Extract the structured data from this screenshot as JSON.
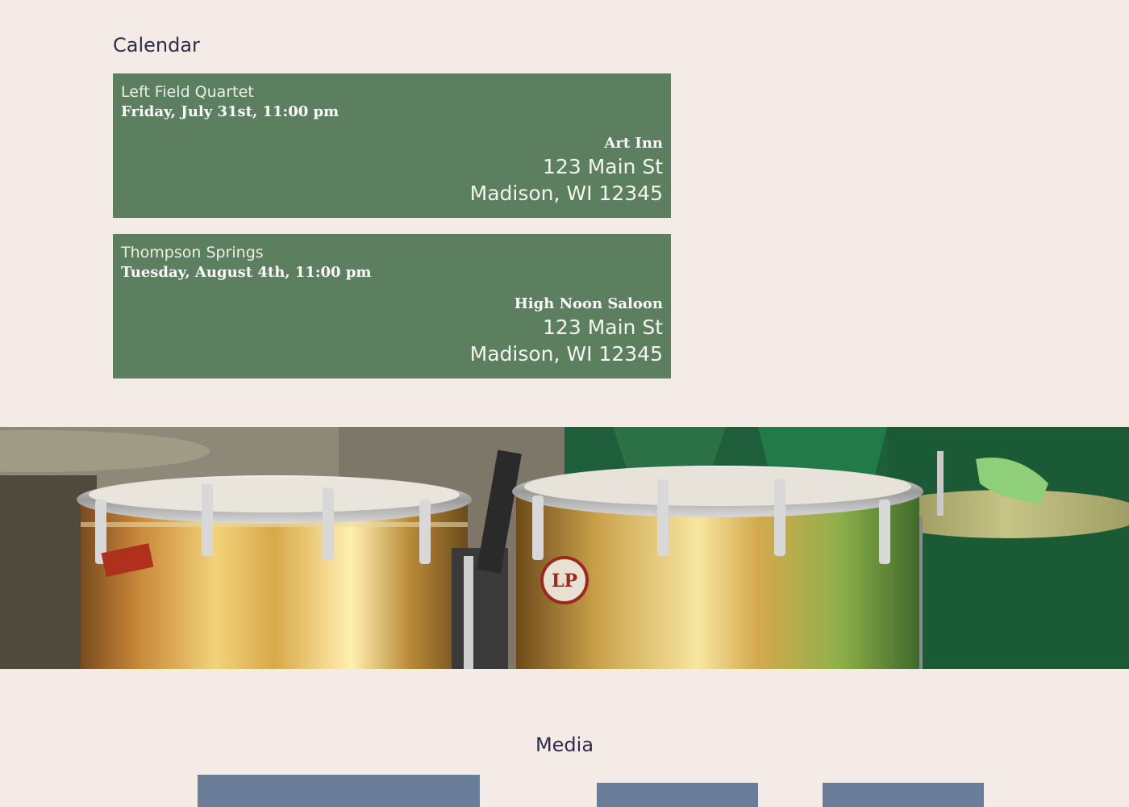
{
  "calendar": {
    "title": "Calendar",
    "events": [
      {
        "band": "Left Field Quartet",
        "date": "Friday, July 31st, 11:00 pm",
        "venue": "Art Inn",
        "street": "123 Main St",
        "city": "Madison, WI 12345"
      },
      {
        "band": "Thompson Springs",
        "date": "Tuesday, August 4th, 11:00 pm",
        "venue": "High Noon Saloon",
        "street": "123 Main St",
        "city": "Madison, WI 12345"
      }
    ]
  },
  "banner": {
    "image": "drum-kit-photo",
    "drum_logo": "LP"
  },
  "media": {
    "title": "Media"
  },
  "colors": {
    "background": "#f4ebe6",
    "card": "#5c805f",
    "heading": "#2e2c4a",
    "media_tile": "#6a7d99"
  }
}
